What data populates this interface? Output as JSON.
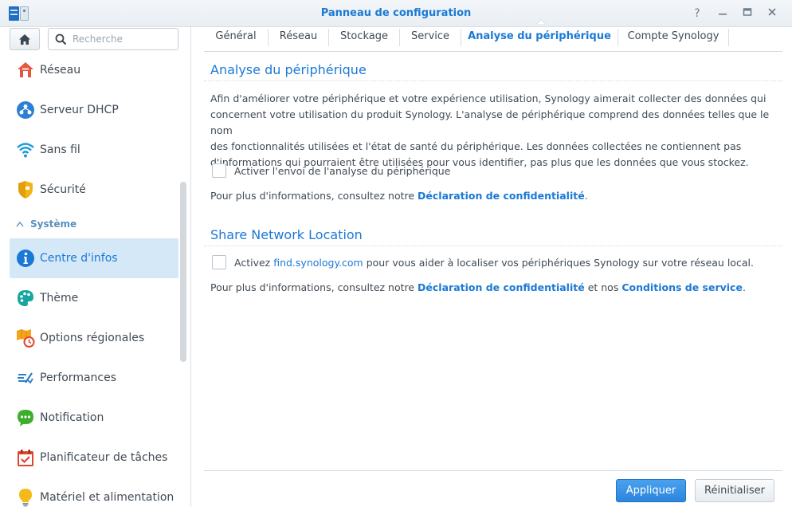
{
  "window": {
    "title": "Panneau de configuration",
    "help": "?",
    "minimize": "—",
    "maximize": "▭",
    "close": "✕"
  },
  "sidebar": {
    "search_placeholder": "Recherche",
    "items": [
      {
        "label": "Réseau",
        "icon": "network-house-icon"
      },
      {
        "label": "Serveur DHCP",
        "icon": "dhcp-icon"
      },
      {
        "label": "Sans fil",
        "icon": "wifi-icon"
      },
      {
        "label": "Sécurité",
        "icon": "shield-icon"
      }
    ],
    "section_label": "Système",
    "system_items": [
      {
        "label": "Centre d'infos",
        "icon": "info-icon",
        "active": true
      },
      {
        "label": "Thème",
        "icon": "palette-icon"
      },
      {
        "label": "Options régionales",
        "icon": "regional-icon"
      },
      {
        "label": "Performances",
        "icon": "performance-icon"
      },
      {
        "label": "Notification",
        "icon": "notification-icon"
      },
      {
        "label": "Planificateur de tâches",
        "icon": "calendar-icon"
      },
      {
        "label": "Matériel et alimentation",
        "icon": "bulb-icon"
      }
    ]
  },
  "tabs": [
    {
      "label": "Général"
    },
    {
      "label": "Réseau"
    },
    {
      "label": "Stockage"
    },
    {
      "label": "Service"
    },
    {
      "label": "Analyse du périphérique",
      "active": true
    },
    {
      "label": "Compte Synology"
    }
  ],
  "analysis": {
    "title": "Analyse du périphérique",
    "description_lines": [
      "Afin d'améliorer votre périphérique et votre expérience utilisation, Synology aimerait collecter des données qui",
      "concernent votre utilisation du produit Synology. L'analyse de périphérique comprend des données telles que le nom",
      "des fonctionnalités utilisées et l'état de santé du périphérique. Les données collectées ne contiennent pas",
      "d'informations qui pourraient être utilisées pour vous identifier, pas plus que les données que vous stockez."
    ],
    "checkbox_label": "Activer l'envoi de l'analyse du périphérique",
    "checked": false,
    "info_prefix": "Pour plus d'informations, consultez notre ",
    "privacy_link": "Déclaration de confidentialité",
    "info_suffix": "."
  },
  "location": {
    "title": "Share Network Location",
    "checkbox_prefix": "Activez ",
    "checkbox_link": "find.synology.com",
    "checkbox_suffix": " pour vous aider à localiser vos périphériques Synology sur votre réseau local.",
    "checked": false,
    "info_prefix": "Pour plus d'informations, consultez notre ",
    "privacy_link": "Déclaration de confidentialité",
    "info_middle": " et nos ",
    "terms_link": "Conditions de service",
    "info_suffix": "."
  },
  "footer": {
    "apply": "Appliquer",
    "reset": "Réinitialiser"
  },
  "colors": {
    "accent": "#1b79d5",
    "active_bg": "#d5e8f8"
  }
}
